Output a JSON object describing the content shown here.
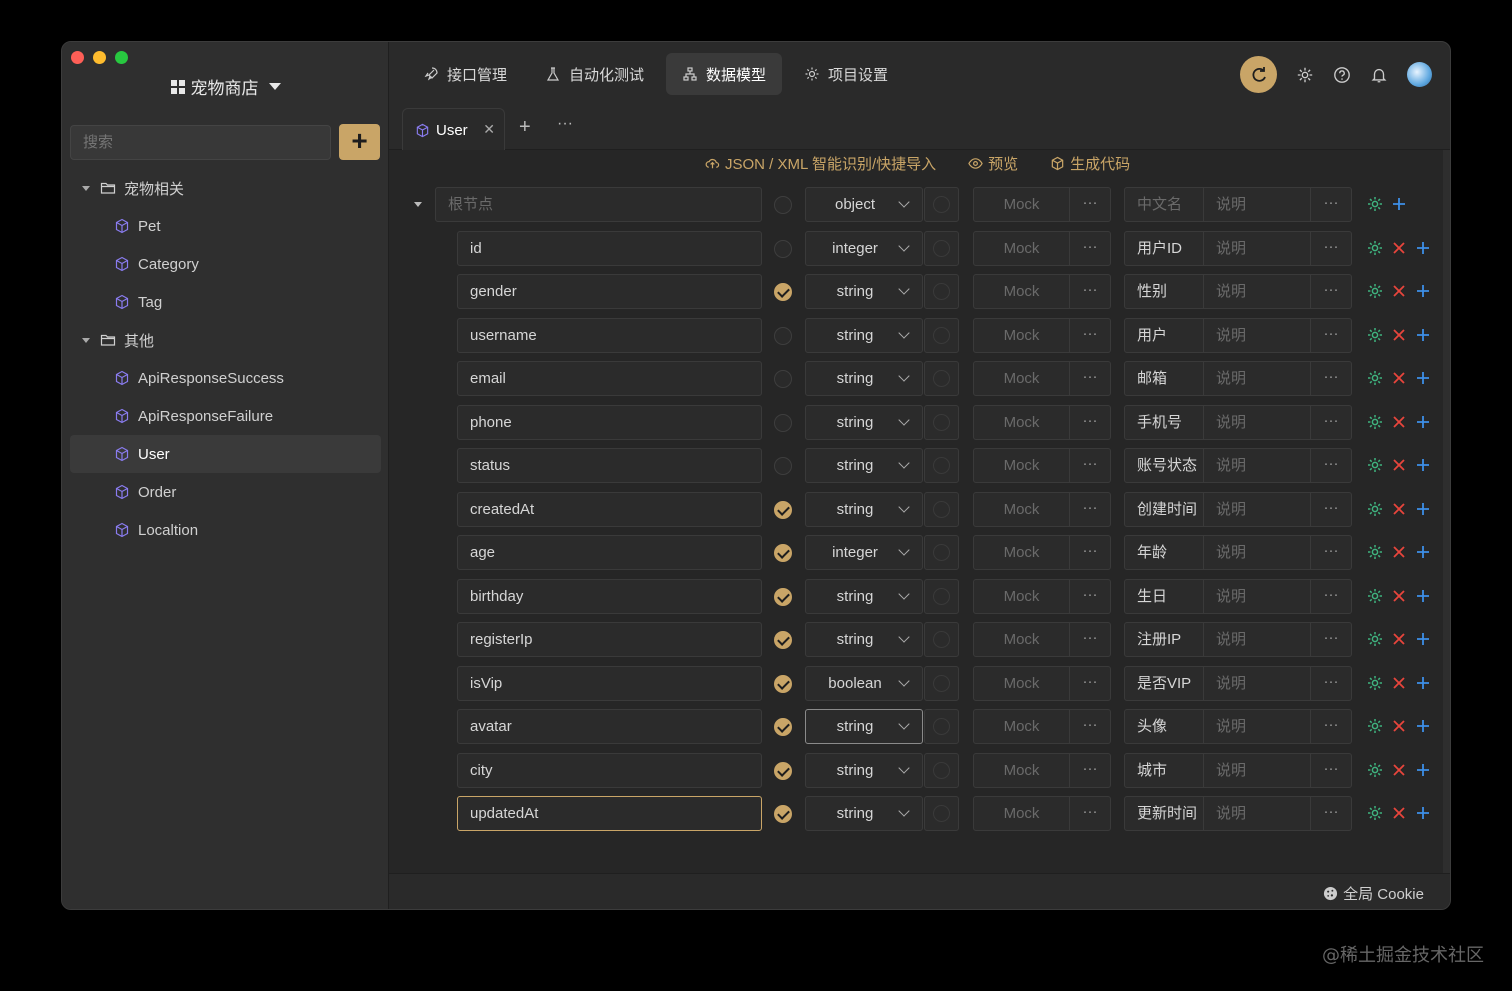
{
  "project": {
    "name": "宠物商店"
  },
  "search": {
    "placeholder": "搜索"
  },
  "sidebar": {
    "add_label": "+",
    "groups": [
      {
        "label": "宠物相关",
        "items": [
          "Pet",
          "Category",
          "Tag"
        ]
      },
      {
        "label": "其他",
        "items": [
          "ApiResponseSuccess",
          "ApiResponseFailure",
          "User",
          "Order",
          "Localtion"
        ]
      }
    ],
    "selected": "User"
  },
  "nav": {
    "items": [
      {
        "label": "接口管理",
        "icon": "rocket-icon"
      },
      {
        "label": "自动化测试",
        "icon": "flask-icon"
      },
      {
        "label": "数据模型",
        "icon": "hierarchy-icon",
        "active": true
      },
      {
        "label": "项目设置",
        "icon": "gear-icon"
      }
    ]
  },
  "tabs": {
    "active": "User",
    "plus": "+",
    "more": "···"
  },
  "actions": {
    "import": "JSON / XML 智能识别/快捷导入",
    "preview": "预览",
    "codegen": "生成代码"
  },
  "root": {
    "name_placeholder": "根节点",
    "type": "object",
    "mock": "Mock",
    "cn_placeholder": "中文名",
    "desc_placeholder": "说明"
  },
  "fields": [
    {
      "name": "id",
      "required": false,
      "type": "integer",
      "cn": "用户ID"
    },
    {
      "name": "gender",
      "required": true,
      "type": "string",
      "cn": "性别"
    },
    {
      "name": "username",
      "required": false,
      "type": "string",
      "cn": "用户"
    },
    {
      "name": "email",
      "required": false,
      "type": "string",
      "cn": "邮箱"
    },
    {
      "name": "phone",
      "required": false,
      "type": "string",
      "cn": "手机号"
    },
    {
      "name": "status",
      "required": false,
      "type": "string",
      "cn": "账号状态"
    },
    {
      "name": "createdAt",
      "required": true,
      "type": "string",
      "cn": "创建时间"
    },
    {
      "name": "age",
      "required": true,
      "type": "integer",
      "cn": "年龄"
    },
    {
      "name": "birthday",
      "required": true,
      "type": "string",
      "cn": "生日"
    },
    {
      "name": "registerIp",
      "required": true,
      "type": "string",
      "cn": "注册IP"
    },
    {
      "name": "isVip",
      "required": true,
      "type": "boolean",
      "cn": "是否VIP"
    },
    {
      "name": "avatar",
      "required": true,
      "type": "string",
      "cn": "头像"
    },
    {
      "name": "city",
      "required": true,
      "type": "string",
      "cn": "城市"
    },
    {
      "name": "updatedAt",
      "required": true,
      "type": "string",
      "cn": "更新时间"
    }
  ],
  "row_labels": {
    "mock": "Mock",
    "desc": "说明",
    "dots": "···"
  },
  "footer": {
    "cookie": "全局 Cookie"
  },
  "watermark": "@稀土掘金技术社区",
  "colors": {
    "accent": "#c9a567",
    "delete": "#e8453c",
    "add": "#3d8fe8",
    "settings": "#3fb37f"
  }
}
